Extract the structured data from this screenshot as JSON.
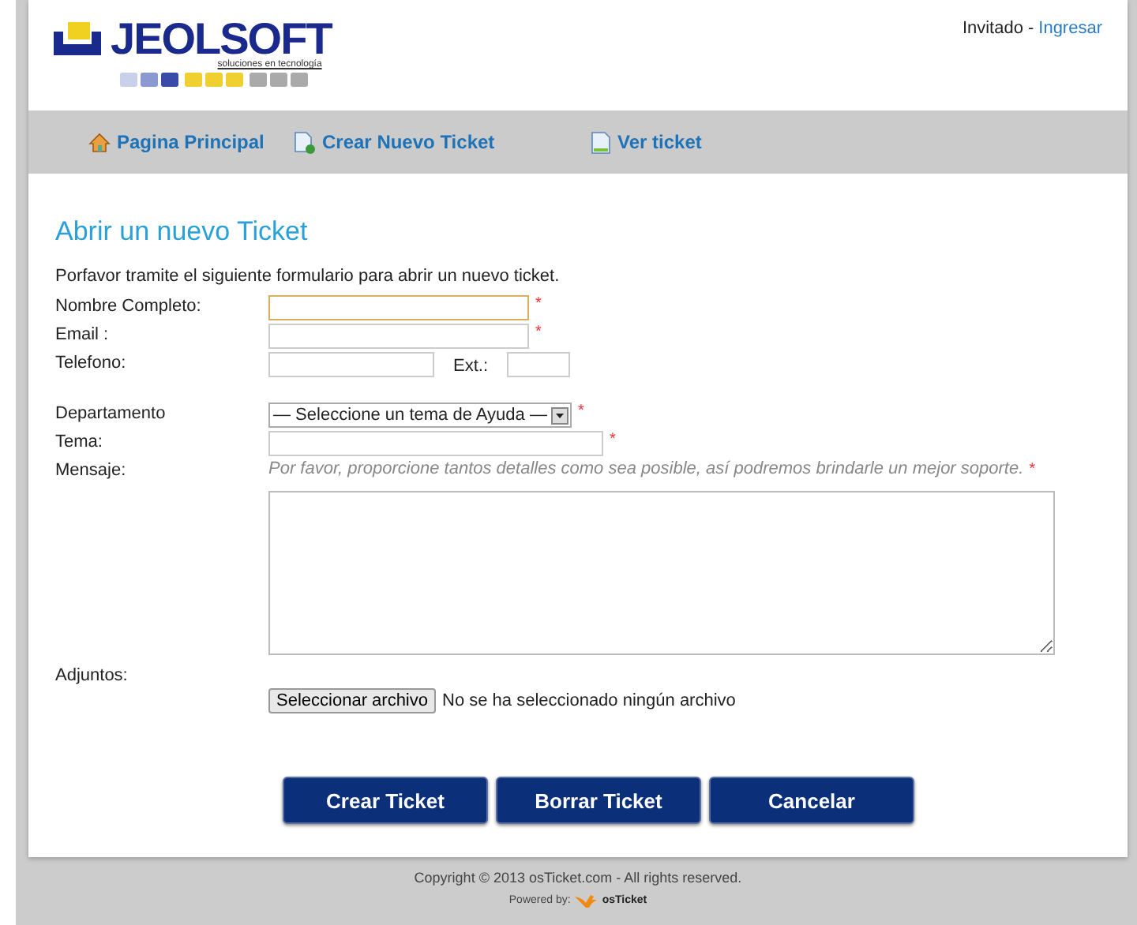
{
  "header": {
    "logo_text": "JEOLSOFT",
    "logo_tagline": "soluciones en tecnología",
    "user_status": "Invitado",
    "separator": "-",
    "login_link": "Ingresar"
  },
  "nav": [
    {
      "label": "Pagina Principal"
    },
    {
      "label": "Crear Nuevo Ticket"
    },
    {
      "label": "Ver ticket"
    }
  ],
  "form": {
    "title": "Abrir un nuevo Ticket",
    "intro": "Porfavor tramite el siguiente formulario para abrir un nuevo ticket.",
    "fields": [
      {
        "kind": "text",
        "label": "Nombre Completo:",
        "required_mark": "*",
        "focused": true
      },
      {
        "kind": "text",
        "label": "Email :",
        "required_mark": "*",
        "focused": false
      },
      {
        "kind": "phone",
        "label": "Telefono:",
        "ext_label": "Ext.:",
        "focused": false
      },
      {
        "kind": "select",
        "label": "Departamento",
        "value": "— Seleccione un tema de Ayuda —",
        "required_mark": "*",
        "focused": false
      },
      {
        "kind": "text",
        "label": "Tema:",
        "required_mark": "*",
        "focused": false
      },
      {
        "kind": "textarea",
        "label": "Mensaje:",
        "hint": "Por favor, proporcione tantos detalles como sea posible, así podremos brindarle un mejor soporte.",
        "required_mark": "*",
        "focused": false
      },
      {
        "kind": "file",
        "label": "Adjuntos:",
        "button": "Seleccionar archivo",
        "status": "No se ha seleccionado ningún archivo",
        "focused": false
      }
    ],
    "buttons": [
      "Crear Ticket",
      "Borrar Ticket",
      "Cancelar"
    ]
  },
  "footer": {
    "copyright": "Copyright © 2013 osTicket.com - All rights reserved.",
    "powered_by": "Powered by:",
    "brand": "osTicket"
  }
}
